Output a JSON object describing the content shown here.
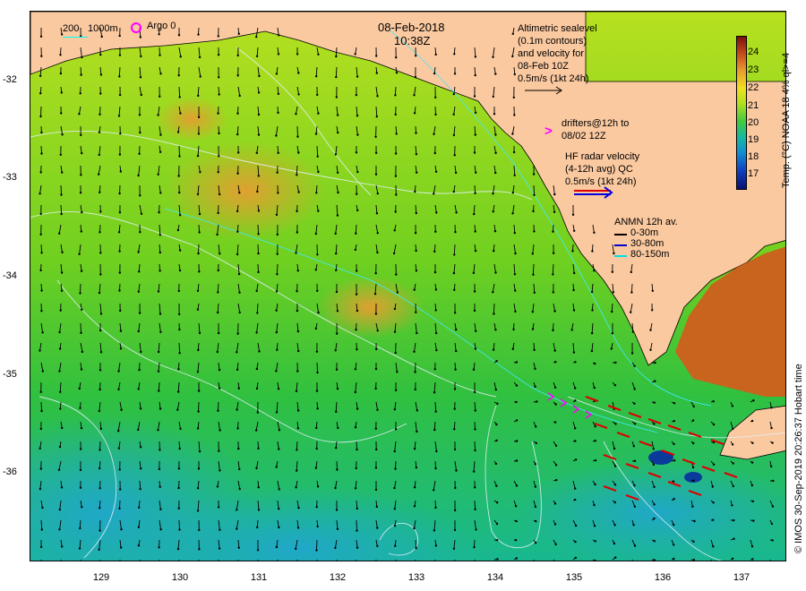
{
  "map": {
    "date": "08-Feb-2018",
    "time": "10:38Z",
    "lat_ticks": [
      "-32",
      "-33",
      "-34",
      "-35",
      "-36"
    ],
    "lon_ticks": [
      "129",
      "130",
      "131",
      "132",
      "133",
      "134",
      "135",
      "136",
      "137"
    ]
  },
  "legend": {
    "depth_200": "200",
    "depth_1000": "1000m",
    "argo": "Argo 0",
    "altimetry": [
      "Altimetric sealevel",
      "(0.1m contours)",
      "and velocity for",
      "08-Feb 10Z",
      "0.5m/s (1kt 24h)"
    ],
    "drifters": [
      "drifters@12h to",
      "08/02 12Z"
    ],
    "hf_radar": [
      "HF radar velocity",
      "(4-12h avg) QC",
      "0.5m/s (1kt 24h)"
    ],
    "anmn_title": "ANMN 12h av.",
    "anmn": [
      "0-30m",
      "30-80m",
      "80-150m"
    ]
  },
  "colorbar": {
    "title": "Temp. (°C) NOAA 18 4% ql>=4",
    "labels": [
      "24",
      "23",
      "22",
      "21",
      "20",
      "19",
      "18",
      "17"
    ]
  },
  "credit": "© IMOS 30-Sep-2019 20:26:37 Hobart time",
  "colors": {
    "land": "#fac9a0",
    "anmn_0_30": "#000000",
    "anmn_30_80": "#0000cc",
    "anmn_80_150": "#00e0e0",
    "drifter": "#ff00ff",
    "hf_radar_red": "#dd0000",
    "hf_radar_blue": "#0000dd"
  }
}
